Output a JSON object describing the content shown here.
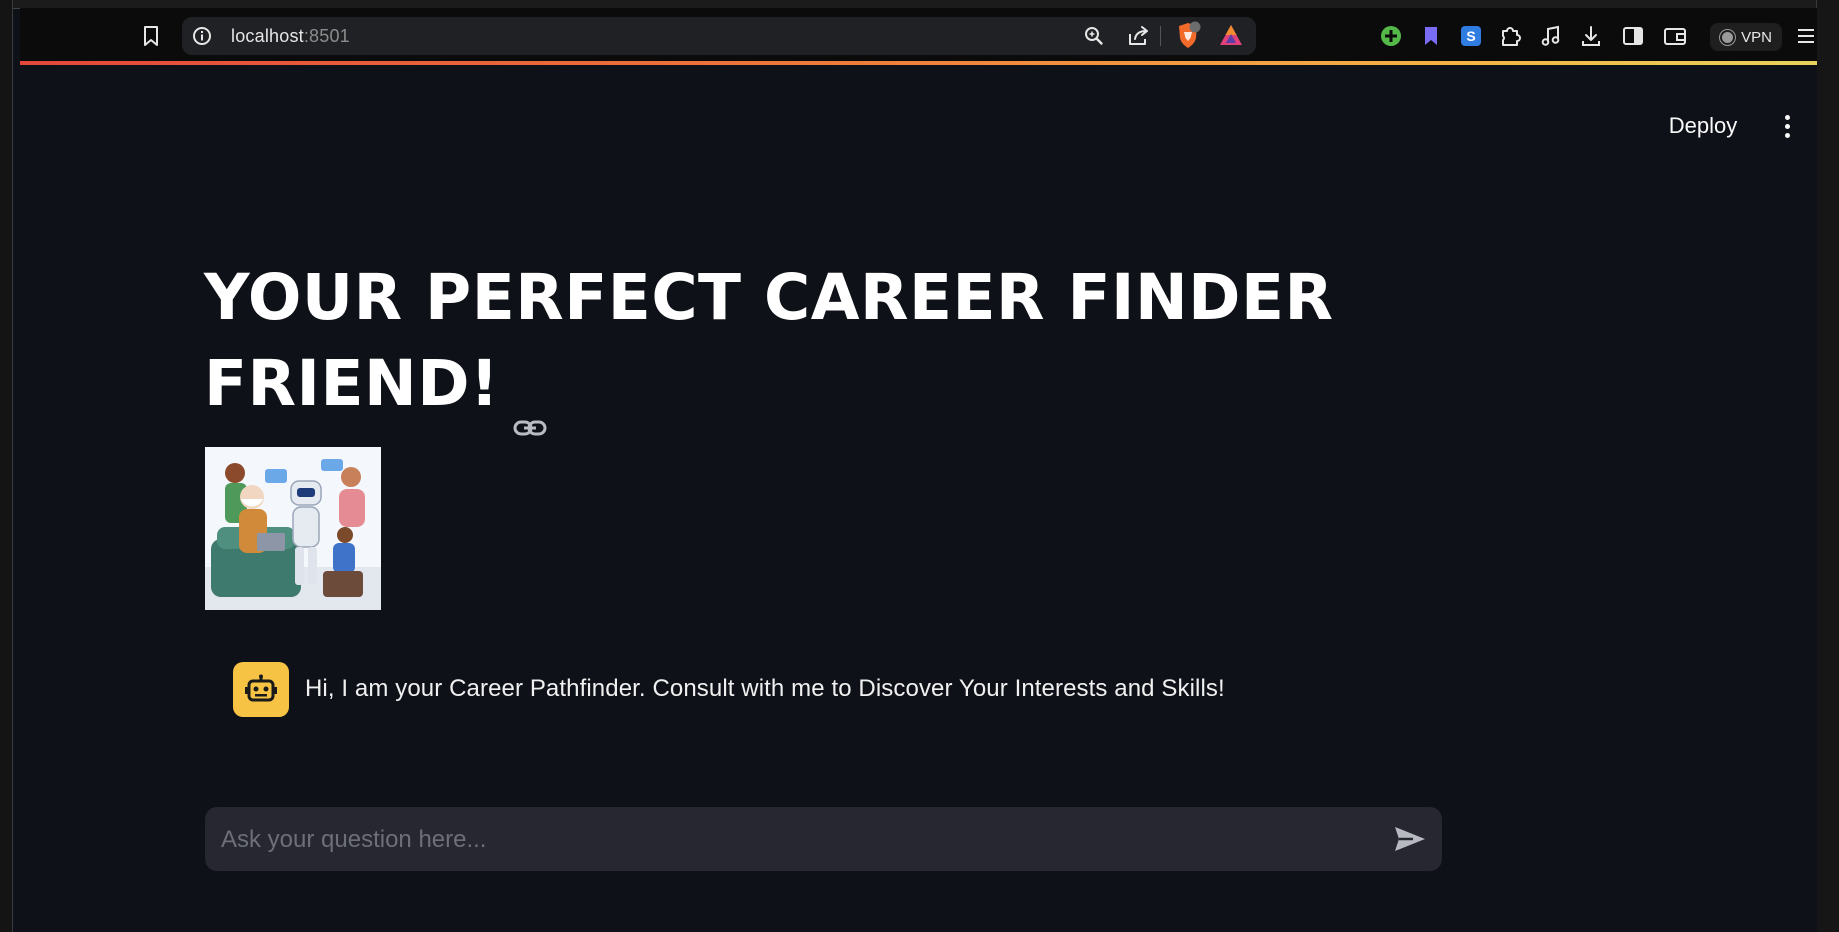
{
  "browser": {
    "address_host": "localhost",
    "address_port": ":8501",
    "vpn_label": "VPN",
    "brave_shield_count": "6",
    "extensions": [
      "add-extension-icon",
      "bookmark-ribbon-icon",
      "s-extension-icon",
      "puzzle-icon",
      "music-note-icon",
      "download-icon",
      "sidebar-icon",
      "wallet-icon"
    ]
  },
  "app": {
    "deploy_label": "Deploy",
    "title": "YOUR PERFECT CAREER FINDER FRIEND!",
    "chat": {
      "message": "Hi, I am your Career Pathfinder. Consult with me to Discover Your Interests and Skills!",
      "input_placeholder": "Ask your question here..."
    }
  },
  "colors": {
    "app_background": "#0e1117",
    "avatar_background": "#f6c344",
    "input_background": "#262730",
    "accent_gradient_start": "#e2473b",
    "accent_gradient_end": "#e8d35a"
  }
}
